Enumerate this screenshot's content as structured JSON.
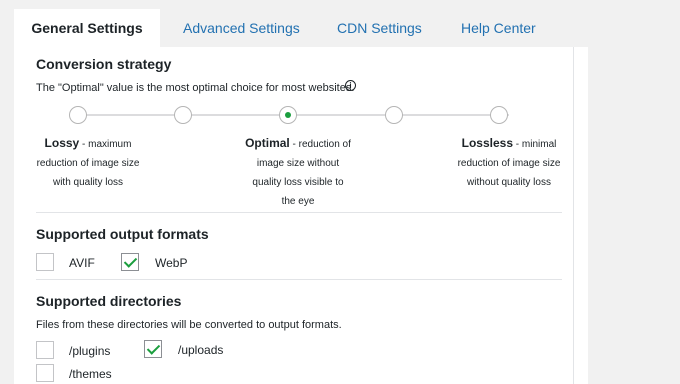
{
  "tabs": [
    {
      "label": "General Settings",
      "active": true
    },
    {
      "label": "Advanced Settings",
      "active": false
    },
    {
      "label": "CDN Settings",
      "active": false
    },
    {
      "label": "Help Center",
      "active": false
    }
  ],
  "conversion": {
    "title": "Conversion strategy",
    "description": "The \"Optimal\" value is the most optimal choice for most websites.",
    "info_icon": "i",
    "selected_step": 3,
    "step_count": 5,
    "options": [
      {
        "name": "Lossy",
        "dash": " - ",
        "lines": [
          "maximum",
          "reduction of image size",
          "with quality loss"
        ]
      },
      {
        "name": "Optimal",
        "dash": " - ",
        "lines": [
          "reduction of",
          "image size without",
          "quality loss visible to",
          "the eye"
        ]
      },
      {
        "name": "Lossless",
        "dash": " - ",
        "lines": [
          "minimal",
          "reduction of image size",
          "without quality loss"
        ]
      }
    ]
  },
  "formats": {
    "title": "Supported output formats",
    "items": [
      {
        "label": "AVIF",
        "checked": false
      },
      {
        "label": "WebP",
        "checked": true
      }
    ]
  },
  "directories": {
    "title": "Supported directories",
    "description": "Files from these directories will be converted to output formats.",
    "items": [
      {
        "label": "/plugins",
        "checked": false
      },
      {
        "label": "/uploads",
        "checked": true
      },
      {
        "label": "/themes",
        "checked": false
      }
    ]
  },
  "colors": {
    "accent_link": "#2271b1",
    "check_green": "#1b9e3e",
    "background": "#f1f1f1"
  }
}
